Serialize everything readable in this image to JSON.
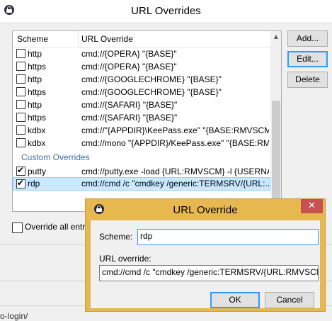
{
  "main_window": {
    "title": "URL Overrides",
    "columns": {
      "scheme": "Scheme",
      "url": "URL Override"
    },
    "rows": [
      {
        "scheme": "http",
        "url": "cmd://{OPERA} \"{BASE}\"",
        "checked": false
      },
      {
        "scheme": "https",
        "url": "cmd://{OPERA} \"{BASE}\"",
        "checked": false
      },
      {
        "scheme": "http",
        "url": "cmd://{GOOGLECHROME} \"{BASE}\"",
        "checked": false
      },
      {
        "scheme": "https",
        "url": "cmd://{GOOGLECHROME} \"{BASE}\"",
        "checked": false
      },
      {
        "scheme": "http",
        "url": "cmd://{SAFARI} \"{BASE}\"",
        "checked": false
      },
      {
        "scheme": "https",
        "url": "cmd://{SAFARI} \"{BASE}\"",
        "checked": false
      },
      {
        "scheme": "kdbx",
        "url": "cmd://\"{APPDIR}\\KeePass.exe\" \"{BASE:RMVSCM...",
        "checked": false
      },
      {
        "scheme": "kdbx",
        "url": "cmd://mono \"{APPDIR}/KeePass.exe\" \"{BASE:RMV...",
        "checked": false
      }
    ],
    "custom_group_label": "Custom Overrides",
    "custom_rows": [
      {
        "scheme": "putty",
        "url": "cmd://putty.exe -load {URL:RMVSCM} -l {USERNA...",
        "checked": true
      },
      {
        "scheme": "rdp",
        "url": "cmd://cmd /c \"cmdkey /generic:TERMSRV/{URL:...",
        "checked": true
      }
    ],
    "buttons": {
      "add": "Add...",
      "edit": "Edit...",
      "delete": "Delete"
    },
    "override_all_label": "Override all entry U",
    "bottom_text": "o-login/"
  },
  "dialog": {
    "title": "URL Override",
    "close_glyph": "✕",
    "scheme_label": "Scheme:",
    "scheme_value": "rdp",
    "url_label": "URL override:",
    "url_value": "cmd://cmd /c \"cmdkey /generic:TERMSRV/{URL:RMVSCM}",
    "ok_label": "OK",
    "cancel_label": "Cancel"
  },
  "colors": {
    "dialog_frame": "#e6b84f",
    "close_button": "#c75050",
    "selection": "#cce8ff",
    "group_label": "#3a6ea5"
  },
  "icons": [
    "lock-icon",
    "close-icon",
    "check-icon",
    "scroll-up-icon",
    "scroll-down-icon",
    "mouse-cursor-icon"
  ]
}
